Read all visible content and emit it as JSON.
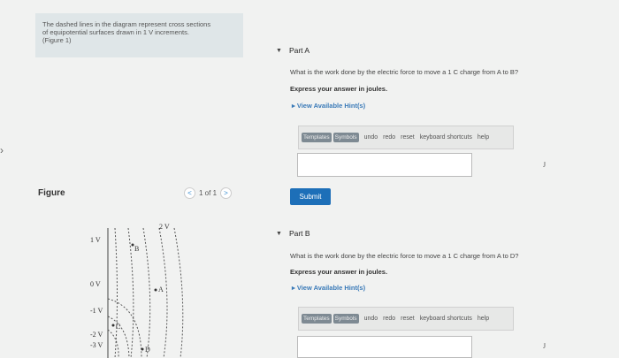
{
  "intro": {
    "line1": "The dashed lines in the diagram represent cross sections",
    "line2": "of equipotential surfaces drawn in 1 V increments.",
    "figure_ref": "(Figure 1)"
  },
  "figure": {
    "label": "Figure",
    "pager": "1 of 1",
    "prev": "<",
    "next": ">",
    "potentials": [
      "1 V",
      "0 V",
      "-1 V",
      "-2 V",
      "-3 V",
      "2 V"
    ],
    "points": [
      "B",
      "A",
      "C",
      "D"
    ]
  },
  "partA": {
    "title": "Part A",
    "question": "What is the work done by the electric force to move a 1 C charge from A to B?",
    "instruction": "Express your answer in joules.",
    "hint": "View Available Hint(s)",
    "toolbar": [
      "Templates",
      "Symbols",
      "undo",
      "redo",
      "reset",
      "keyboard shortcuts",
      "help"
    ],
    "unit": "J",
    "submit": "Submit"
  },
  "partB": {
    "title": "Part B",
    "question": "What is the work done by the electric force to move a 1 C charge from A to D?",
    "instruction": "Express your answer in joules.",
    "hint": "View Available Hint(s)",
    "toolbar": [
      "Templates",
      "Symbols",
      "undo",
      "redo",
      "reset",
      "keyboard shortcuts",
      "help"
    ],
    "unit": "J"
  }
}
